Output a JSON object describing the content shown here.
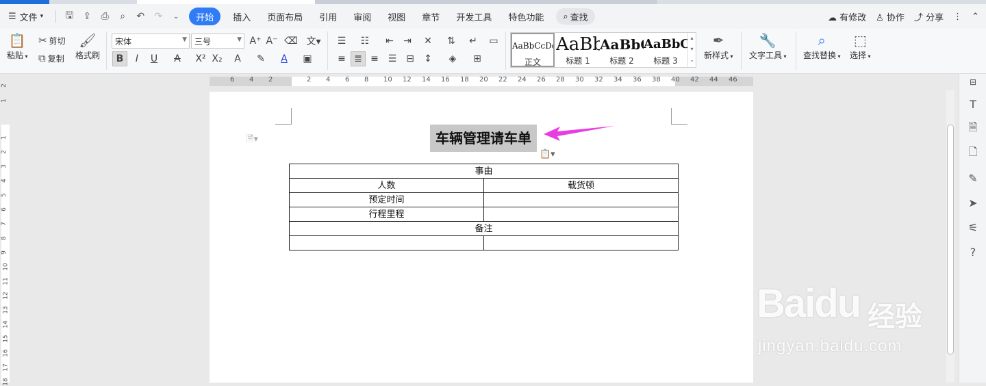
{
  "menu": {
    "file": "文件",
    "tabs": [
      "开始",
      "插入",
      "页面布局",
      "引用",
      "审阅",
      "视图",
      "章节",
      "开发工具",
      "特色功能"
    ],
    "search": "查找",
    "right": {
      "modified": "有修改",
      "collab": "协作",
      "share": "分享"
    }
  },
  "ribbon": {
    "paste": "粘贴",
    "cut": "剪切",
    "copy": "复制",
    "format_painter": "格式刷",
    "font_name": "宋体",
    "font_size": "三号",
    "styles": [
      {
        "preview": "AaBbCcDd",
        "label": "正文"
      },
      {
        "preview": "AaBb",
        "label": "标题 1"
      },
      {
        "preview": "AaBbC",
        "label": "标题 2"
      },
      {
        "preview": "AaBbC",
        "label": "标题 3"
      }
    ],
    "new_style": "新样式",
    "text_tools": "文字工具",
    "find_replace": "查找替换",
    "select": "选择"
  },
  "ruler": {
    "h": [
      "6",
      "4",
      "2",
      "2",
      "4",
      "6",
      "8",
      "10",
      "12",
      "14",
      "16",
      "18",
      "20",
      "22",
      "24",
      "26",
      "28",
      "30",
      "32",
      "34",
      "36",
      "38",
      "40",
      "42",
      "44",
      "46"
    ],
    "v": [
      "2",
      "1",
      "1",
      "2",
      "3",
      "4",
      "5",
      "6",
      "7",
      "8",
      "9",
      "10",
      "11",
      "12",
      "13",
      "14",
      "15",
      "16",
      "17",
      "18"
    ]
  },
  "document": {
    "title": "车辆管理请车单",
    "table": {
      "rows": [
        {
          "span": true,
          "cells": [
            "事由"
          ]
        },
        {
          "span": false,
          "cells": [
            "人数",
            "载货顿"
          ]
        },
        {
          "span": false,
          "cells": [
            "预定时间",
            ""
          ]
        },
        {
          "span": false,
          "cells": [
            "行程里程",
            ""
          ]
        },
        {
          "span": true,
          "cells": [
            "备注"
          ]
        },
        {
          "span": false,
          "cells": [
            "",
            ""
          ]
        }
      ]
    }
  },
  "watermark": {
    "logo": "Baidu",
    "cn": "经验",
    "url": "jingyan.baidu.com"
  },
  "colors": {
    "accent": "#2f7cf6",
    "arrow": "#e83ee0"
  }
}
